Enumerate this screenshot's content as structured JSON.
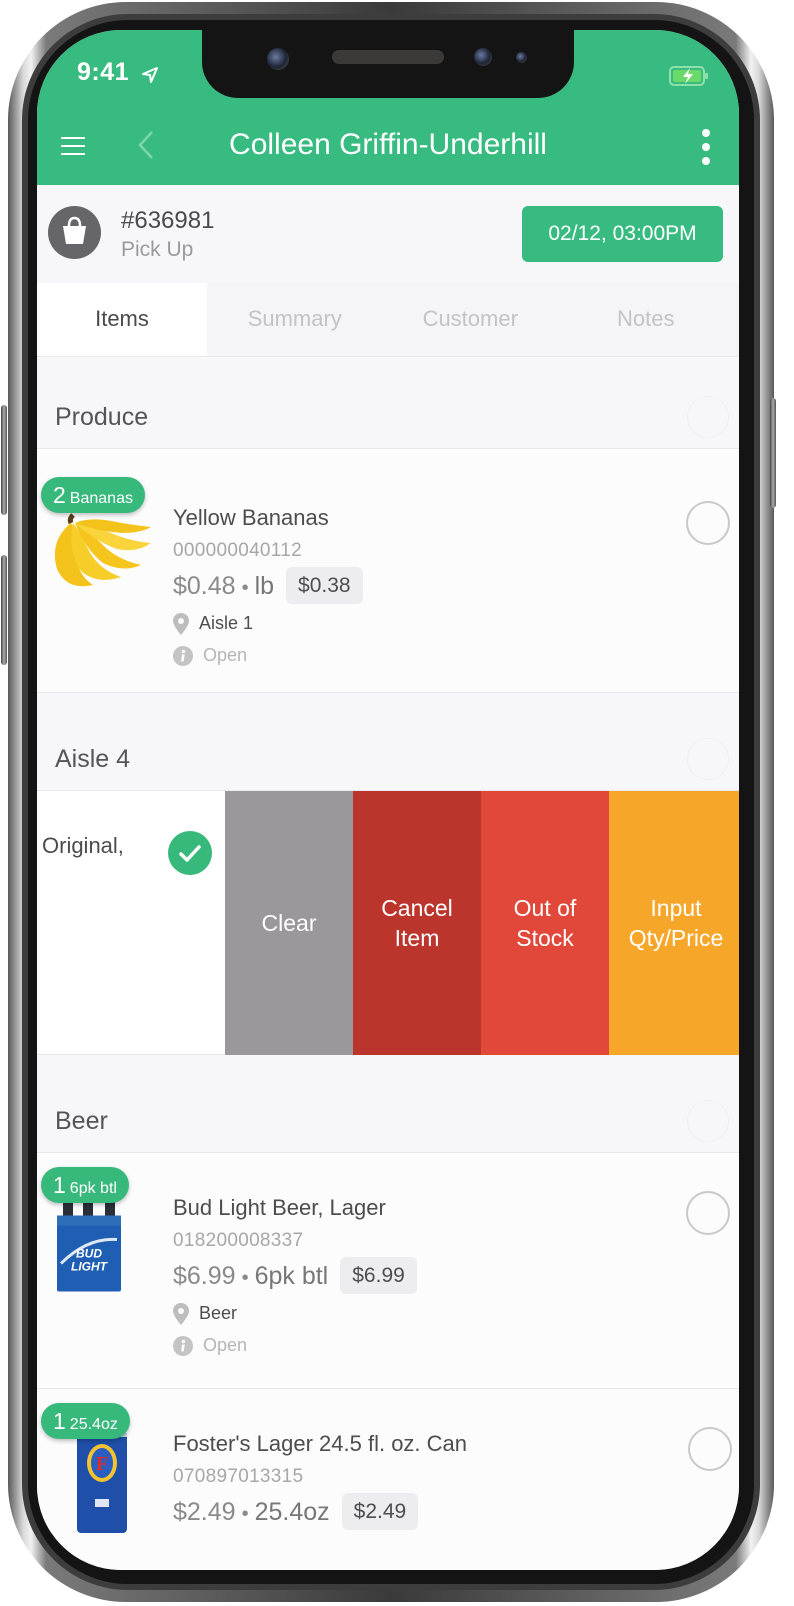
{
  "status_bar": {
    "time": "9:41",
    "location_icon": "location-arrow-icon",
    "battery_icon": "battery-charging-icon"
  },
  "header": {
    "title": "Colleen Griffin-Underhill",
    "menu_icon": "hamburger-menu-icon",
    "back_icon": "chevron-left-icon",
    "more_icon": "more-vertical-icon"
  },
  "order": {
    "number": "#636981",
    "type": "Pick Up",
    "datetime": "02/12, 03:00PM",
    "avatar_icon": "shopping-bag-icon"
  },
  "tabs": [
    {
      "label": "Items",
      "active": true
    },
    {
      "label": "Summary",
      "active": false
    },
    {
      "label": "Customer",
      "active": false
    },
    {
      "label": "Notes",
      "active": false
    }
  ],
  "sections": [
    {
      "title": "Produce",
      "items": [
        {
          "qty": "2",
          "unit_label": "Bananas",
          "name": "Yellow Bananas",
          "code": "000000040112",
          "price": "$0.48",
          "unit": "lb",
          "chip_price": "$0.38",
          "location": "Aisle 1",
          "status": "Open",
          "image": "bananas-image"
        }
      ]
    },
    {
      "title": "Aisle 4",
      "swiped_item": {
        "partial_text": "Original,",
        "checked": true,
        "actions": [
          {
            "label": "Clear",
            "color": "#9a989a"
          },
          {
            "label": "Cancel\nItem",
            "color": "#bc352d"
          },
          {
            "label": "Out of\nStock",
            "color": "#e2483a"
          },
          {
            "label": "Input\nQty/Price",
            "color": "#f6a72a"
          }
        ]
      }
    },
    {
      "title": "Beer",
      "items": [
        {
          "qty": "1",
          "unit_label": "6pk btl",
          "name": "Bud Light Beer, Lager",
          "code": "018200008337",
          "price": "$6.99",
          "unit": "6pk btl",
          "chip_price": "$6.99",
          "location": "Beer",
          "status": "Open",
          "image": "bud-light-6pack-image"
        },
        {
          "qty": "1",
          "unit_label": "25.4oz",
          "name": "Foster's Lager 24.5 fl. oz. Can",
          "code": "070897013315",
          "price": "$2.49",
          "unit": "25.4oz",
          "chip_price": "$2.49",
          "image": "fosters-can-image"
        }
      ]
    }
  ],
  "colors": {
    "brand_green": "#38bb80",
    "clear": "#9a989a",
    "cancel": "#bc352d",
    "out_of_stock": "#e2483a",
    "input_qty": "#f6a72a"
  }
}
